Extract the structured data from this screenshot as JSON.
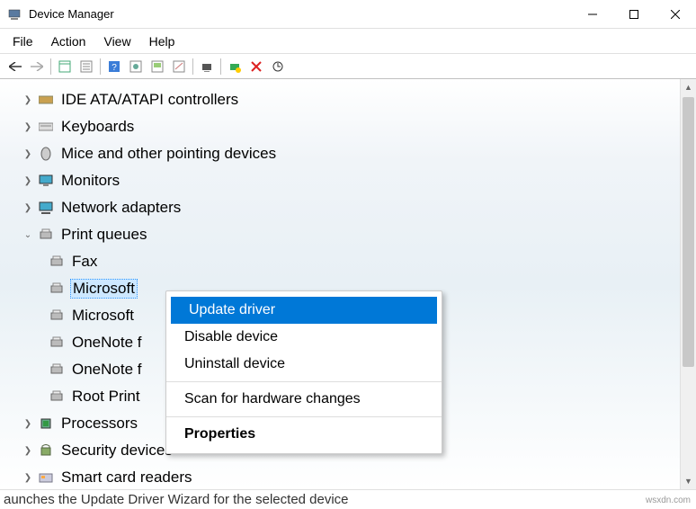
{
  "titlebar": {
    "title": "Device Manager"
  },
  "menubar": {
    "file": "File",
    "action": "Action",
    "view": "View",
    "help": "Help"
  },
  "tree": {
    "categories": [
      {
        "label": "IDE ATA/ATAPI controllers",
        "expanded": false
      },
      {
        "label": "Keyboards",
        "expanded": false
      },
      {
        "label": "Mice and other pointing devices",
        "expanded": false
      },
      {
        "label": "Monitors",
        "expanded": false
      },
      {
        "label": "Network adapters",
        "expanded": false
      },
      {
        "label": "Print queues",
        "expanded": true,
        "children": [
          {
            "label": "Fax"
          },
          {
            "label": "Microsoft",
            "selected": true
          },
          {
            "label": "Microsoft"
          },
          {
            "label": "OneNote f"
          },
          {
            "label": "OneNote f"
          },
          {
            "label": "Root Print"
          }
        ]
      },
      {
        "label": "Processors",
        "expanded": false
      },
      {
        "label": "Security devices",
        "expanded": false
      },
      {
        "label": "Smart card readers",
        "expanded": false
      }
    ]
  },
  "contextmenu": {
    "update": "Update driver",
    "disable": "Disable device",
    "uninstall": "Uninstall device",
    "scan": "Scan for hardware changes",
    "properties": "Properties"
  },
  "statusbar": {
    "text": "aunches the Update Driver Wizard for the selected device"
  },
  "watermark": "wsxdn.com"
}
